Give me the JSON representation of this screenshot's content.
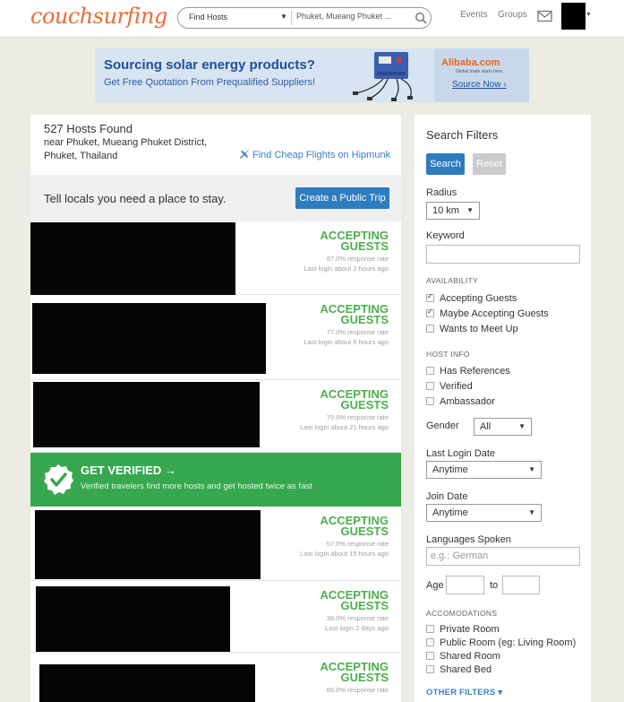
{
  "header": {
    "logo": "couchsurfing",
    "search_mode": "Find Hosts",
    "search_location": "Phuket, Mueang Phuket ...",
    "nav": [
      "Events",
      "Groups"
    ]
  },
  "ad": {
    "headline": "Sourcing solar energy products?",
    "subline": "Get Free Quotation From Prequalified Suppliers!",
    "brand": "Alibaba.com",
    "brand_tagline": "Global trade starts here.",
    "cta": "Source Now ›"
  },
  "results": {
    "count_text": "527 Hosts Found",
    "near_text": "near Phuket, Mueang Phuket District, Phuket, Thailand",
    "flights_link": "Find Cheap Flights on Hipmunk",
    "tell_text": "Tell locals you need a place to stay.",
    "trip_button": "Create a Public Trip"
  },
  "hosts": [
    {
      "status": "ACCEPTING GUESTS",
      "rate": "87.0% response rate",
      "login": "Last login about 2 hours ago"
    },
    {
      "status": "ACCEPTING GUESTS",
      "rate": "77.0% response rate",
      "login": "Last login about 6 hours ago"
    },
    {
      "status": "ACCEPTING GUESTS",
      "rate": "79.0% response rate",
      "login": "Last login about 21 hours ago"
    },
    {
      "status": "ACCEPTING GUESTS",
      "rate": "57.0% response rate",
      "login": "Last login about 15 hours ago"
    },
    {
      "status": "ACCEPTING GUESTS",
      "rate": "38.0% response rate",
      "login": "Last login 2 days ago"
    },
    {
      "status": "ACCEPTING GUESTS",
      "rate": "86.0% response rate",
      "login": ""
    }
  ],
  "verified": {
    "title": "GET VERIFIED →",
    "subtitle": "Verified travelers find more hosts and get hosted twice as fast"
  },
  "filters": {
    "title": "Search Filters",
    "search_btn": "Search",
    "reset_btn": "Reset",
    "radius_label": "Radius",
    "radius_value": "10 km",
    "keyword_label": "Keyword",
    "availability_heading": "AVAILABILITY",
    "availability": [
      {
        "label": "Accepting Guests",
        "checked": true
      },
      {
        "label": "Maybe Accepting Guests",
        "checked": true
      },
      {
        "label": "Wants to Meet Up",
        "checked": false
      }
    ],
    "host_info_heading": "HOST INFO",
    "host_info": [
      {
        "label": "Has References",
        "checked": false
      },
      {
        "label": "Verified",
        "checked": false
      },
      {
        "label": "Ambassador",
        "checked": false
      }
    ],
    "gender_label": "Gender",
    "gender_value": "All",
    "last_login_label": "Last Login Date",
    "last_login_value": "Anytime",
    "join_date_label": "Join Date",
    "join_date_value": "Anytime",
    "languages_label": "Languages Spoken",
    "languages_placeholder": "e.g.: German",
    "age_label": "Age",
    "age_to": "to",
    "accommodations_heading": "ACCOMODATIONS",
    "accommodations": [
      {
        "label": "Private Room",
        "checked": false
      },
      {
        "label": "Public Room (eg: Living Room)",
        "checked": false
      },
      {
        "label": "Shared Room",
        "checked": false
      },
      {
        "label": "Shared Bed",
        "checked": false
      }
    ],
    "other_filters": "OTHER FILTERS ▾"
  },
  "colors": {
    "brand_orange": "#ed6b35",
    "primary_blue": "#2f7bbf",
    "accept_green": "#4cae4c",
    "verified_green": "#37a84f"
  }
}
